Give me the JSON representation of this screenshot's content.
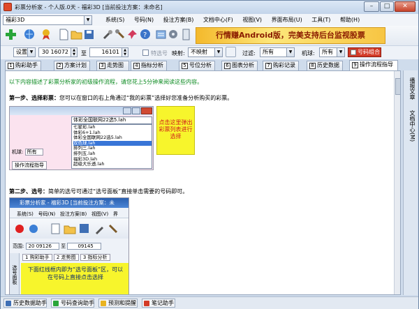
{
  "window": {
    "title": "彩票分析家 - 个人版.0天 - 福彩3D [当前投注方案：未命名]",
    "min": "–",
    "max": "□",
    "close": "✕"
  },
  "lottery_select": {
    "value": "福彩3D"
  },
  "menu": [
    "系统(S)",
    "号码(N)",
    "投注方案(B)",
    "文档中心(F)",
    "视图(V)",
    "界面布局(U)",
    "工具(T)",
    "帮助(H)"
  ],
  "banner": {
    "text": "行情赚Android版，完美支持后台监视股票"
  },
  "filter_row": {
    "settings_label": "设置",
    "from_value": "30 16072",
    "to_label": "至",
    "to_value": "16101",
    "special_label": "特选号",
    "map_label": "映射:",
    "map_value": "不映射",
    "filter_label": "过滤:",
    "filter_value": "所有",
    "machine_label": "机球:",
    "machine_value": "所有",
    "combo_button": "号码组合"
  },
  "tabs": [
    {
      "num": "1",
      "label": "购彩助手"
    },
    {
      "num": "2",
      "label": "方案计划"
    },
    {
      "num": "3",
      "label": "走势图"
    },
    {
      "num": "4",
      "label": "指标分析"
    },
    {
      "num": "5",
      "label": "号位分析"
    },
    {
      "num": "6",
      "label": "图表分析"
    },
    {
      "num": "7",
      "label": "购彩记录"
    },
    {
      "num": "8",
      "label": "历史数据"
    },
    {
      "num": "9",
      "label": "操作流程指导"
    }
  ],
  "content": {
    "intro": "以下内容描述了彩票分析家的初级操作流程，请您花上5分钟来阅读这些内容。",
    "step1_title": "第一步、选择彩票：",
    "step1_text": "您可以在窗口的右上角通过“我的彩票”选择好您准备分析购买的彩票。",
    "step1_shot": {
      "selected": "体彩全国联网22选5.lah",
      "options": [
        "七星彩.lah",
        "体彩6+1.lah",
        "体彩全国联网22选5.lah",
        "双色球.lah",
        "排列三.lah",
        "排列五.lah",
        "福彩3D.lah",
        "超级大乐透.lah"
      ],
      "machine_label": "机球:",
      "machine_value": "所有",
      "tab_label": "操作流程指导"
    },
    "step1_callout": "点击这里弹出彩票列表进行选择",
    "step2_title": "第二步、选号：",
    "step2_text": "简单的选号可通过“选号面板”直接单击需要的号码即可。",
    "step2_shot": {
      "title": "彩票分析家 - 福彩3D [当前投注方案：未",
      "menu": [
        "系统(S)",
        "号码(N)",
        "投注方案(B)",
        "视图(V)",
        "界"
      ],
      "range_label": "范围:",
      "range_from": "20 09126",
      "range_to_label": "至",
      "range_to": "09145",
      "tabs": [
        "购彩助手",
        "走势图",
        "指标分析"
      ],
      "side_label": "选号面板",
      "callout": "下面红线框内即为“选号面板”区，可以在号码上直接点击选择"
    }
  },
  "right_sidebar": [
    "播报文章",
    "文档中心(M)"
  ],
  "bottom_tabs": [
    "历史数据助手",
    "号码查询助手",
    "预测和提醒",
    "笔记助手"
  ]
}
